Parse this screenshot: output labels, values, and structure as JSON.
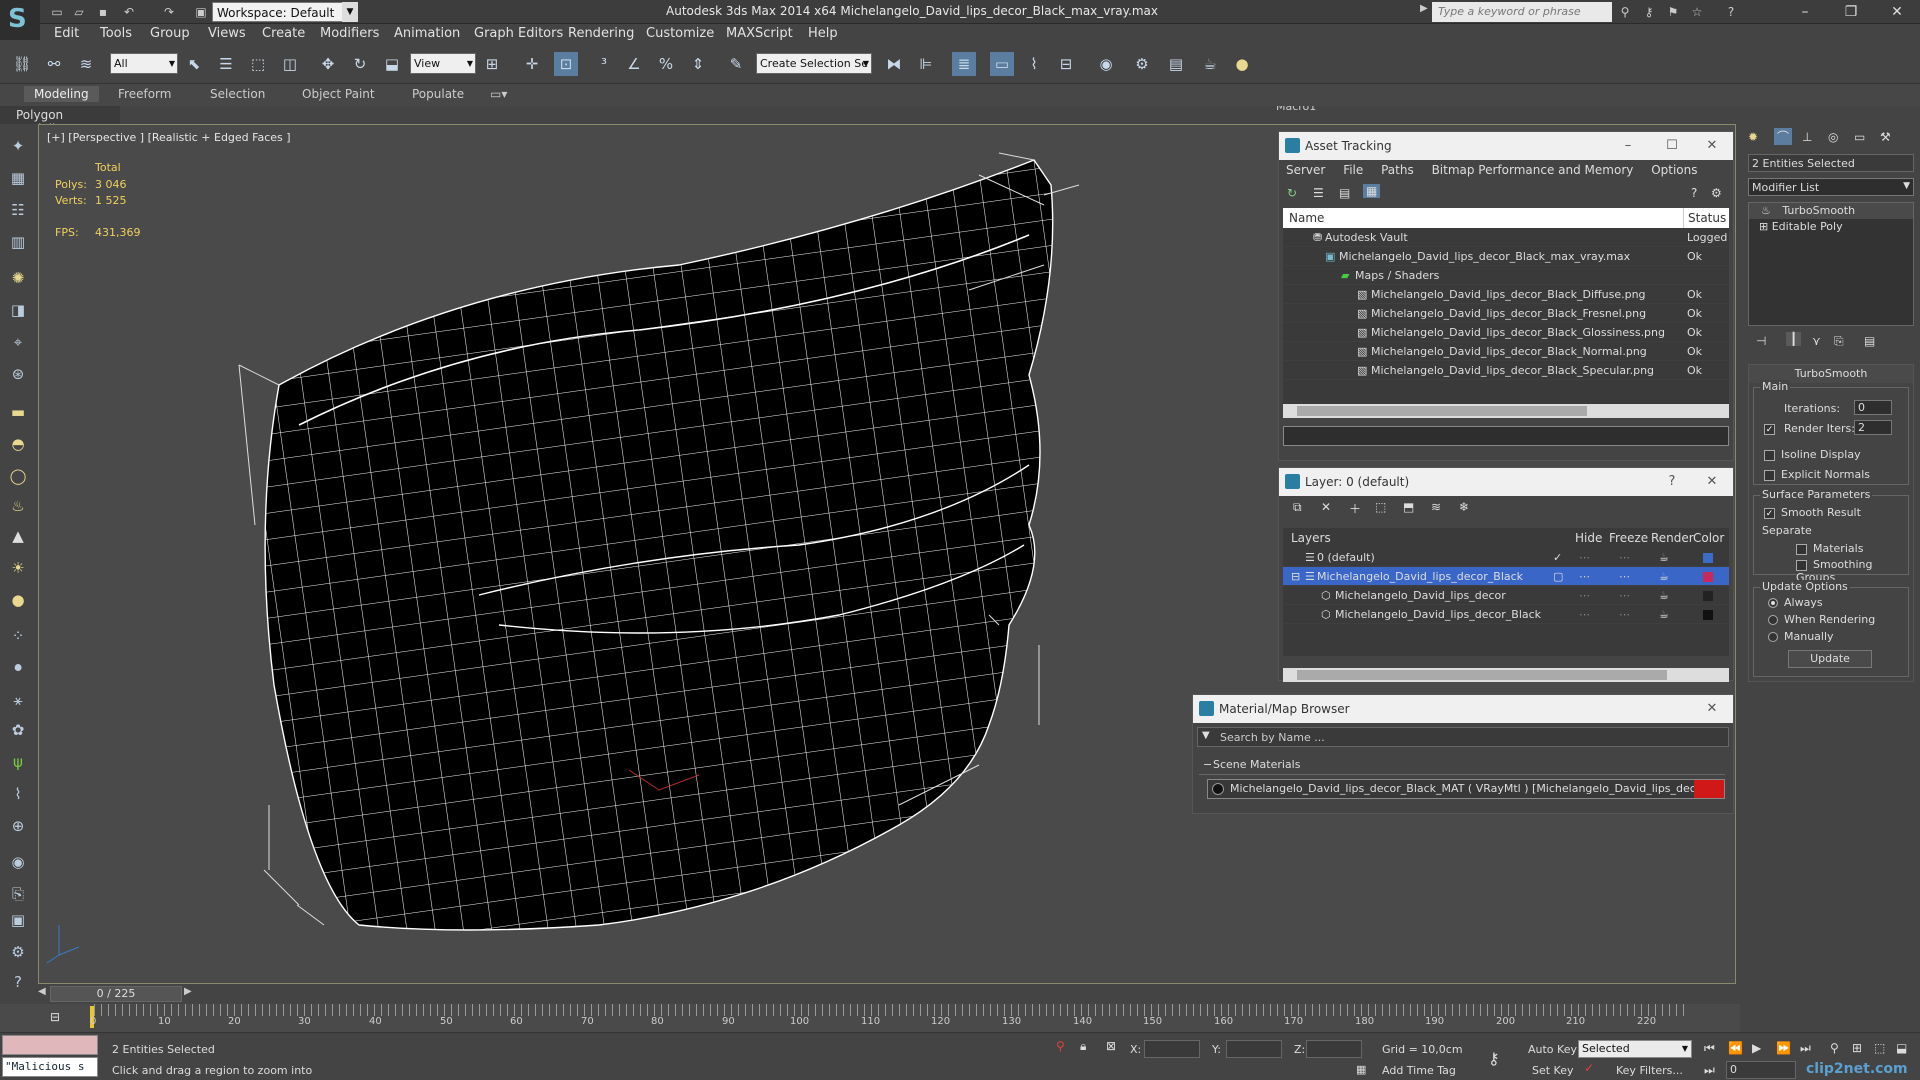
{
  "app": {
    "title": "Autodesk 3ds Max  2014 x64    Michelangelo_David_lips_decor_Black_max_vray.max",
    "workspace": "Workspace: Default",
    "search_placeholder": "Type a keyword or phrase"
  },
  "menu": [
    "Edit",
    "Tools",
    "Group",
    "Views",
    "Create",
    "Modifiers",
    "Animation",
    "Graph Editors",
    "Rendering",
    "Customize",
    "MAXScript",
    "Help"
  ],
  "toolbar": {
    "selection_filter": "All",
    "ref_coord": "View",
    "named_selection": "Create Selection Se",
    "macro": "Macro1"
  },
  "ribbon": {
    "tabs": [
      "Modeling",
      "Freeform",
      "Selection",
      "Object Paint",
      "Populate"
    ],
    "sub": "Polygon Modeling"
  },
  "viewport": {
    "label": "[+] [Perspective ] [Realistic + Edged Faces ]",
    "stats": {
      "total_label": "Total",
      "polys_label": "Polys:",
      "polys": "3 046",
      "verts_label": "Verts:",
      "verts": "1 525",
      "fps_label": "FPS:",
      "fps": "431,369"
    }
  },
  "asset_tracking": {
    "title": "Asset Tracking",
    "menu": [
      "Server",
      "File",
      "Paths",
      "Bitmap Performance and Memory",
      "Options"
    ],
    "col_name": "Name",
    "col_status": "Status",
    "rows": [
      {
        "name": "Autodesk Vault",
        "status": "Logged"
      },
      {
        "name": "Michelangelo_David_lips_decor_Black_max_vray.max",
        "status": "Ok"
      },
      {
        "name": "Maps / Shaders",
        "status": ""
      },
      {
        "name": "Michelangelo_David_lips_decor_Black_Diffuse.png",
        "status": "Ok"
      },
      {
        "name": "Michelangelo_David_lips_decor_Black_Fresnel.png",
        "status": "Ok"
      },
      {
        "name": "Michelangelo_David_lips_decor_Black_Glossiness.png",
        "status": "Ok"
      },
      {
        "name": "Michelangelo_David_lips_decor_Black_Normal.png",
        "status": "Ok"
      },
      {
        "name": "Michelangelo_David_lips_decor_Black_Specular.png",
        "status": "Ok"
      }
    ]
  },
  "layers": {
    "title": "Layer: 0 (default)",
    "cols": [
      "Layers",
      "Hide",
      "Freeze",
      "Render",
      "Color"
    ],
    "rows": [
      {
        "name": "0 (default)",
        "color": "#3a6cc8"
      },
      {
        "name": "Michelangelo_David_lips_decor_Black",
        "color": "#c8285a"
      },
      {
        "name": "Michelangelo_David_lips_decor",
        "color": "#222222"
      },
      {
        "name": "Michelangelo_David_lips_decor_Black",
        "color": "#111111"
      }
    ]
  },
  "material_browser": {
    "title": "Material/Map Browser",
    "search_placeholder": "Search by Name ...",
    "group": "Scene Materials",
    "item": "Michelangelo_David_lips_decor_Black_MAT ( VRayMtl ) [Michelangelo_David_lips_decor]"
  },
  "command_panel": {
    "selection": "2 Entities Selected",
    "modifier_list": "Modifier List",
    "stack": [
      "TurboSmooth",
      "Editable Poly"
    ],
    "rollout_title": "TurboSmooth",
    "main_label": "Main",
    "iterations_label": "Iterations:",
    "iterations": "0",
    "render_iters_label": "Render Iters:",
    "render_iters": "2",
    "isoline": "Isoline Display",
    "explicit_normals": "Explicit Normals",
    "surface_params": "Surface Parameters",
    "smooth_result": "Smooth Result",
    "separate": "Separate",
    "materials": "Materials",
    "smoothing_groups": "Smoothing Groups",
    "update_options": "Update Options",
    "always": "Always",
    "when_rendering": "When Rendering",
    "manually": "Manually",
    "update_btn": "Update"
  },
  "timeline": {
    "frame": "0 / 225",
    "ticks": [
      "0",
      "10",
      "20",
      "30",
      "40",
      "50",
      "60",
      "70",
      "80",
      "90",
      "100",
      "110",
      "120",
      "130",
      "140",
      "150",
      "160",
      "170",
      "180",
      "190",
      "200",
      "210",
      "220"
    ]
  },
  "status": {
    "maxscript": "\"Malicious s",
    "selected": "2 Entities Selected",
    "prompt": "Click and drag a region to zoom into",
    "x_label": "X:",
    "y_label": "Y:",
    "z_label": "Z:",
    "grid": "Grid = 10,0cm",
    "add_time_tag": "Add Time Tag",
    "auto_key": "Auto Key",
    "set_key": "Set Key",
    "selected_dropdown": "Selected",
    "key_filters": "Key Filters...",
    "frame_value": "0",
    "watermark": "clip2net.com"
  }
}
